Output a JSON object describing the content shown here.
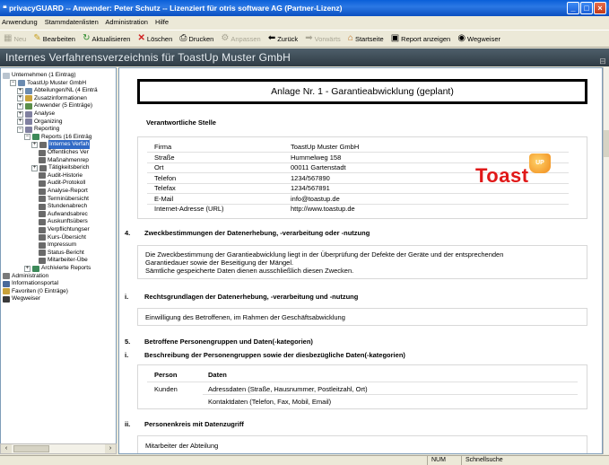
{
  "window": {
    "title": "privacyGUARD -- Anwender: Peter Schutz -- Lizenziert für otris software AG (Partner-Lizenz)"
  },
  "menu": [
    "Anwendung",
    "Stammdatenlisten",
    "Administration",
    "Hilfe"
  ],
  "toolbar": {
    "neu": "Neu",
    "bearbeiten": "Bearbeiten",
    "aktualisieren": "Aktualisieren",
    "loeschen": "Löschen",
    "drucken": "Drucken",
    "anpassen": "Anpassen",
    "zurueck": "Zurück",
    "vorwaerts": "Vorwärts",
    "startseite": "Startseite",
    "report": "Report anzeigen",
    "wegweiser": "Wegweiser"
  },
  "banner": "Internes Verfahrensverzeichnis für ToastUp Muster GmbH",
  "tree": [
    "Unternehmen (1 Eintrag)",
    "ToastUp Muster GmbH",
    "Abteilungen/NL (4 Einträ",
    "Zusatzinformationen",
    "Anwender (5 Einträge)",
    "Analyse",
    "Organizing",
    "Reporting",
    "Reports (16 Einträg",
    "Internes Verfah",
    "Öffentliches Ver",
    "Maßnahmenrep",
    "Tätigkeitsberich",
    "Audit-Historie",
    "Audit-Protokoll",
    "Analyse-Report",
    "Terminübersicht",
    "Stundenabrech",
    "Aufwandsabrec",
    "Auskunftsübers",
    "Verpflichtungser",
    "Kurs-Übersicht",
    "Impressum",
    "Status-Bericht",
    "Mitarbeiter-Übe",
    "Archivierte Reports",
    "Administration",
    "Informationsportal",
    "Favoriten (0 Einträge)",
    "Wegweiser"
  ],
  "doc": {
    "title": "Anlage Nr. 1 - Garantieabwicklung  (geplant)",
    "stelle_heading": "Verantwortliche Stelle",
    "stelle": [
      {
        "label": "Firma",
        "value": "ToastUp Muster GmbH"
      },
      {
        "label": "Straße",
        "value": "Hummelweg 158"
      },
      {
        "label": "Ort",
        "value": "00011 Gartenstadt"
      },
      {
        "label": "Telefon",
        "value": "1234/567890"
      },
      {
        "label": "Telefax",
        "value": "1234/567891"
      },
      {
        "label": "E-Mail",
        "value": "info@toastup.de"
      },
      {
        "label": "Internet-Adresse (URL)",
        "value": "http://www.toastup.de"
      }
    ],
    "logo_text": "Toast",
    "logo_cup": "UP",
    "s4_num": "4.",
    "s4_title": "Zweckbestimmungen der Datenerhebung, -verarbeitung oder -nutzung",
    "s4_text1": "Die Zweckbestimmung der Garantieabwicklung liegt in der Überprüfung der Defekte der Geräte und der entsprechenden",
    "s4_text2": "Garantiedauer sowie der Beseitigung der Mängel.",
    "s4_text3": "Sämtliche gespeicherte Daten dienen ausschließlich diesen Zwecken.",
    "si_num": "i.",
    "si_title": "Rechtsgrundlagen der Datenerhebung, -verarbeitung und -nutzung",
    "si_text": "Einwilligung des Betroffenen, im Rahmen der Geschäftsabwicklung",
    "s5_num": "5.",
    "s5_title": "Betroffene Personengruppen und Daten(-kategorien)",
    "s5i_num": "i.",
    "s5i_title": "Beschreibung der Personengruppen sowie der diesbezügliche Daten(-kategorien)",
    "table_head": {
      "person": "Person",
      "daten": "Daten"
    },
    "table_person": "Kunden",
    "table_daten1": "Adressdaten (Straße, Hausnummer, Postleitzahl, Ort)",
    "table_daten2": "Kontaktdaten (Telefon, Fax, Mobil, Email)",
    "s5ii_num": "ii.",
    "s5ii_title": "Personenkreis mit Datenzugriff",
    "s5ii_text": "Mitarbeiter der Abteilung"
  },
  "status": {
    "num": "NUM",
    "search": "Schnellsuche"
  }
}
